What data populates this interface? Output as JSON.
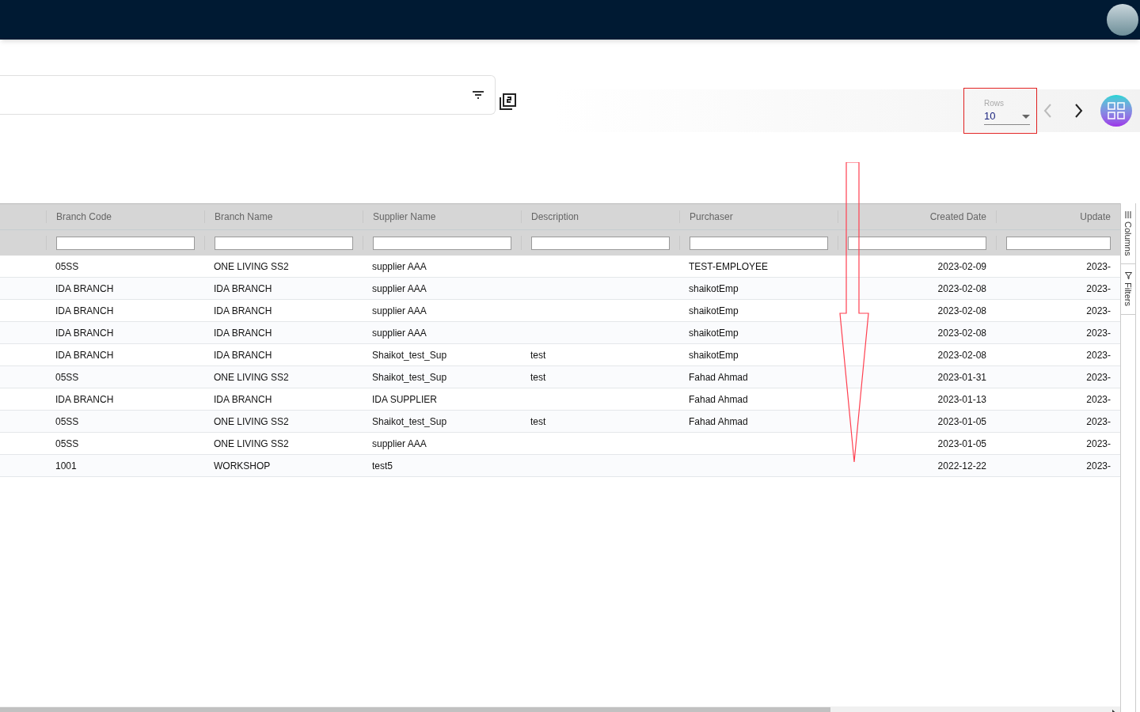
{
  "pager": {
    "rows_label": "Rows",
    "rows_value": "10"
  },
  "table": {
    "columns": [
      {
        "label": "Branch Code",
        "kind": "text"
      },
      {
        "label": "Branch Name",
        "kind": "text"
      },
      {
        "label": "Supplier Name",
        "kind": "text"
      },
      {
        "label": "Description",
        "kind": "text"
      },
      {
        "label": "Purchaser",
        "kind": "text"
      },
      {
        "label": "Created Date",
        "kind": "date"
      },
      {
        "label": "Update",
        "kind": "date"
      }
    ],
    "rows": [
      [
        "05SS",
        "ONE LIVING SS2",
        "supplier AAA",
        null,
        "TEST-EMPLOYEE",
        "2023-02-09",
        "2023-"
      ],
      [
        "IDA BRANCH",
        "IDA BRANCH",
        "supplier AAA",
        null,
        "shaikotEmp",
        "2023-02-08",
        "2023-"
      ],
      [
        "IDA BRANCH",
        "IDA BRANCH",
        "supplier AAA",
        null,
        "shaikotEmp",
        "2023-02-08",
        "2023-"
      ],
      [
        "IDA BRANCH",
        "IDA BRANCH",
        "supplier AAA",
        null,
        "shaikotEmp",
        "2023-02-08",
        "2023-"
      ],
      [
        "IDA BRANCH",
        "IDA BRANCH",
        "Shaikot_test_Sup",
        "test",
        "shaikotEmp",
        "2023-02-08",
        "2023-"
      ],
      [
        "05SS",
        "ONE LIVING SS2",
        "Shaikot_test_Sup",
        "test",
        "Fahad Ahmad",
        "2023-01-31",
        "2023-"
      ],
      [
        "IDA BRANCH",
        "IDA BRANCH",
        "IDA SUPPLIER",
        null,
        "Fahad Ahmad",
        "2023-01-13",
        "2023-"
      ],
      [
        "05SS",
        "ONE LIVING SS2",
        "Shaikot_test_Sup",
        "test",
        "Fahad Ahmad",
        "2023-01-05",
        "2023-"
      ],
      [
        "05SS",
        "ONE LIVING SS2",
        "supplier AAA",
        null,
        null,
        "2023-01-05",
        "2023-"
      ],
      [
        "1001",
        "WORKSHOP",
        "test5",
        null,
        null,
        "2022-12-22",
        "2023-"
      ]
    ]
  },
  "side_panel": [
    {
      "label": "Columns",
      "kind": "columns"
    },
    {
      "label": "Filters",
      "kind": "filters"
    }
  ]
}
